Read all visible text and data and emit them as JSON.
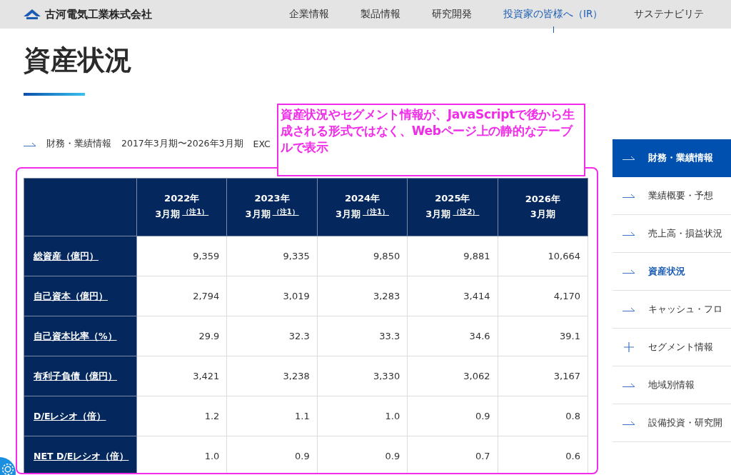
{
  "header": {
    "logo": "古河電気工業株式会社",
    "nav": [
      {
        "label": "企業情報",
        "selected": false
      },
      {
        "label": "製品情報",
        "selected": false
      },
      {
        "label": "研究開発",
        "selected": false
      },
      {
        "label": "投資家の皆様へ（IR）",
        "selected": true
      },
      {
        "label": "サステナビリテ",
        "selected": false
      }
    ]
  },
  "page_title": "資産状況",
  "breadcrumb": {
    "items": [
      "財務・業績情報",
      "2017年3月期〜2026年3月期",
      "EXC"
    ]
  },
  "annotation": {
    "text": "資産状況やセグメント情報が、JavaScriptで後から生成される形式ではなく、Webページ上の静的なテーブルで表示"
  },
  "table": {
    "columns": [
      {
        "year": "2022年",
        "period": "3月期",
        "note": "（注1）"
      },
      {
        "year": "2023年",
        "period": "3月期",
        "note": "（注1）"
      },
      {
        "year": "2024年",
        "period": "3月期",
        "note": "（注1）"
      },
      {
        "year": "2025年",
        "period": "3月期",
        "note": "（注2）"
      },
      {
        "year": "2026年",
        "period": "3月期"
      }
    ],
    "rows": [
      {
        "label": "総資産（億円）",
        "values": [
          "9,359",
          "9,335",
          "9,850",
          "9,881",
          "10,664"
        ]
      },
      {
        "label": "自己資本（億円）",
        "values": [
          "2,794",
          "3,019",
          "3,283",
          "3,414",
          "4,170"
        ]
      },
      {
        "label": "自己資本比率（%）",
        "values": [
          "29.9",
          "32.3",
          "33.3",
          "34.6",
          "39.1"
        ]
      },
      {
        "label": "有利子負債（億円）",
        "values": [
          "3,421",
          "3,238",
          "3,330",
          "3,062",
          "3,167"
        ]
      },
      {
        "label": "D/Eレシオ（倍）",
        "values": [
          "1.2",
          "1.1",
          "1.0",
          "0.9",
          "0.8"
        ]
      },
      {
        "label": "NET D/Eレシオ（倍）",
        "values": [
          "1.0",
          "0.9",
          "0.9",
          "0.7",
          "0.6"
        ]
      }
    ]
  },
  "sidebar": {
    "items": [
      {
        "label": "財務・業績情報",
        "kind": "heading",
        "selected": false
      },
      {
        "label": "業績概要・予想",
        "kind": "link",
        "selected": false
      },
      {
        "label": "売上高・損益状況",
        "kind": "link",
        "selected": false
      },
      {
        "label": "資産状況",
        "kind": "link",
        "selected": true
      },
      {
        "label": "キャッシュ・フロ",
        "kind": "link",
        "selected": false
      },
      {
        "label": "セグメント情報",
        "kind": "expandable",
        "selected": false
      },
      {
        "label": "地域別情報",
        "kind": "link",
        "selected": false
      },
      {
        "label": "設備投資・研究開",
        "kind": "link",
        "selected": false
      }
    ]
  }
}
